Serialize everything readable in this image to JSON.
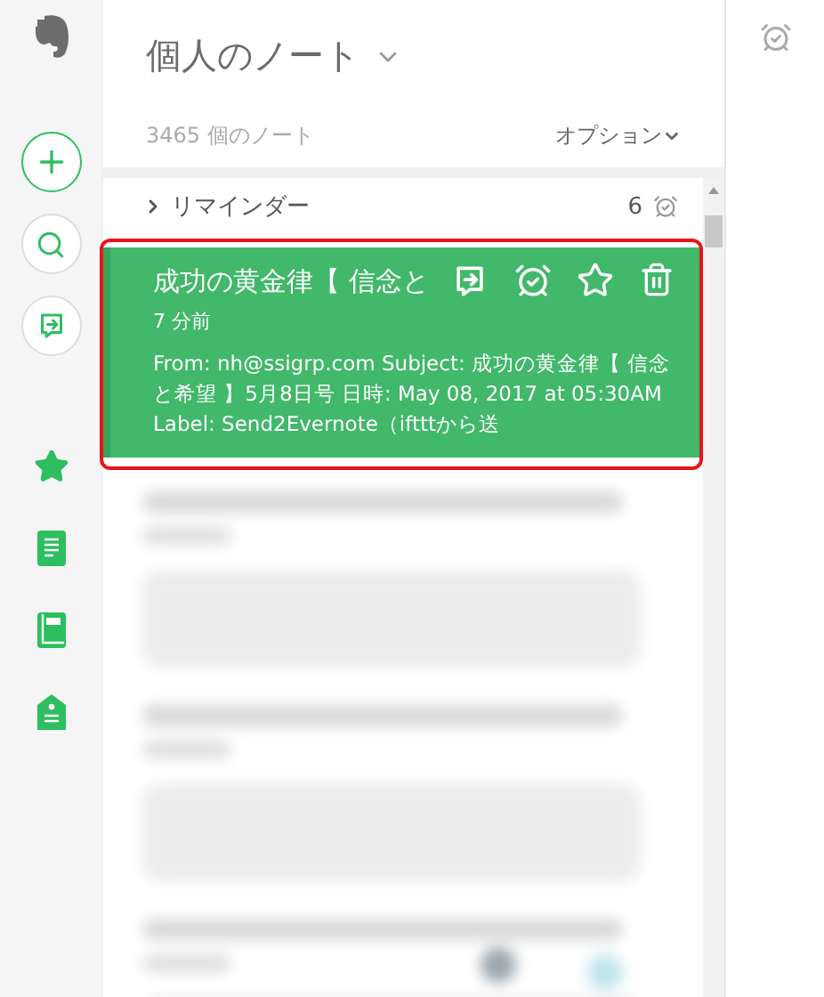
{
  "notebook": {
    "title": "個人のノート",
    "note_count": "3465 個のノート",
    "options_label": "オプション"
  },
  "reminders": {
    "label": "リマインダー",
    "count": "6",
    "expanded": false
  },
  "notes": [
    {
      "title": "成功の黄金律【 信念と",
      "time": "7 分前",
      "snippet": "From: nh@ssigrp.com Subject: 成功の黄金律【 信念と希望 】5月8日号 日時: May 08, 2017 at 05:30AM Label: Send2Evernote（iftttから送",
      "selected": true,
      "outlined": true
    }
  ]
}
